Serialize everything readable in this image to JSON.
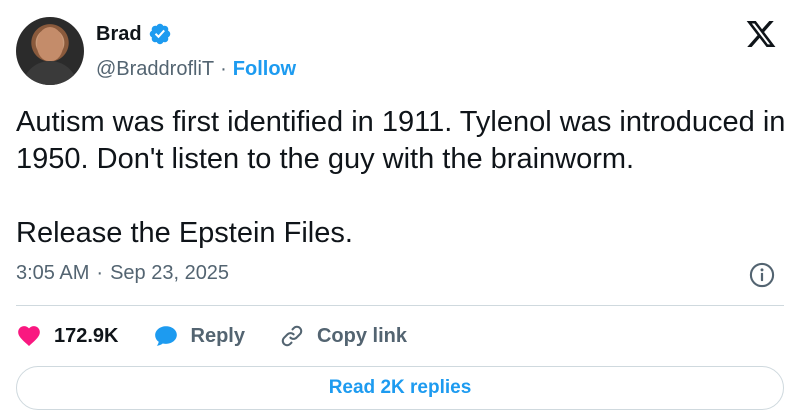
{
  "author": {
    "display_name": "Brad",
    "handle": "@BraddrofliT",
    "separator": "·",
    "follow_label": "Follow"
  },
  "tweet": {
    "text_line_1": "Autism was first identified in 1911. Tylenol was introduced in 1950. Don't listen to the guy with the brainworm.",
    "text_line_2": "Release the Epstein Files.",
    "time": "3:05 AM",
    "date": "Sep 23, 2025"
  },
  "actions": {
    "likes_count": "172.9K",
    "reply_label": "Reply",
    "copy_link_label": "Copy link"
  },
  "replies_button": "Read 2K replies",
  "icons": {
    "verified": "verified-badge-icon",
    "brand": "x-logo-icon",
    "info": "info-icon",
    "like": "heart-icon",
    "reply": "speech-bubble-icon",
    "copy": "link-icon"
  },
  "colors": {
    "accent": "#1d9bf0",
    "like": "#f91880",
    "text": "#0f1419",
    "secondary": "#536471",
    "border": "#cfd9de"
  }
}
